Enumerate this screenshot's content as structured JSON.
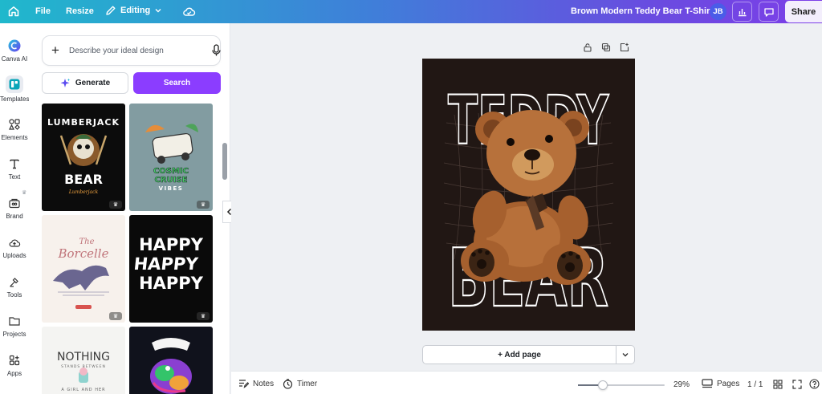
{
  "topbar": {
    "home_icon": "home-icon",
    "file_label": "File",
    "resize_label": "Resize",
    "editing_label": "Editing",
    "cloud_icon": "cloud-sync-icon",
    "doc_title": "Brown Modern Teddy Bear T-Shirt",
    "avatar_initials": "JB",
    "share_label": "Share"
  },
  "rail": {
    "items": [
      {
        "label": "Canva AI",
        "icon": "canva-ai-icon"
      },
      {
        "label": "Templates",
        "icon": "templates-icon"
      },
      {
        "label": "Elements",
        "icon": "elements-icon"
      },
      {
        "label": "Text",
        "icon": "text-icon"
      },
      {
        "label": "Brand",
        "icon": "brand-icon"
      },
      {
        "label": "Uploads",
        "icon": "uploads-icon"
      },
      {
        "label": "Tools",
        "icon": "tools-icon"
      },
      {
        "label": "Projects",
        "icon": "projects-icon"
      },
      {
        "label": "Apps",
        "icon": "apps-icon"
      }
    ]
  },
  "panel": {
    "prompt_placeholder": "Describe your ideal design",
    "generate_label": "Generate",
    "search_label": "Search",
    "templates": [
      {
        "name": "Lumberjack Bear",
        "text1": "LUMBERJACK",
        "text2": "BEAR"
      },
      {
        "name": "Cosmic Cruise Vibes",
        "text1": "COSMIC",
        "text2": "CRUISE",
        "text3": "VIBES"
      },
      {
        "name": "The Borcelle",
        "text1": "The",
        "text2": "Borcelle"
      },
      {
        "name": "Happy Happy Happy",
        "text1": "HAPPY",
        "text2": "HAPPY",
        "text3": "HAPPY"
      },
      {
        "name": "Nothing Stands Between",
        "text1": "NOTHING",
        "text2": "STANDS BETWEEN",
        "text3": "A GIRL AND HER"
      },
      {
        "name": "Graffiti Dino",
        "text1": ""
      }
    ]
  },
  "canvas": {
    "word_top": "TEDDY",
    "word_bottom": "BEAR",
    "add_page_label": "+ Add page"
  },
  "bottombar": {
    "notes_label": "Notes",
    "timer_label": "Timer",
    "zoom_value": 29,
    "zoom_label": "29%",
    "pages_label": "Pages",
    "page_count": "1 / 1"
  },
  "colors": {
    "accent_purple": "#8b3dff",
    "page_bg": "#211714"
  }
}
